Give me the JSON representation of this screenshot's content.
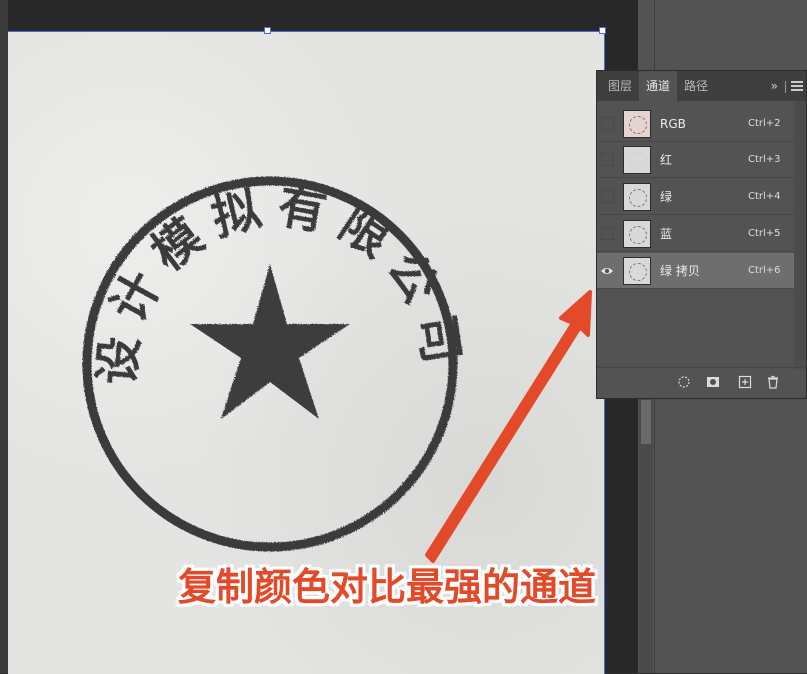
{
  "panel": {
    "tabs": [
      {
        "label": "图层",
        "active": false
      },
      {
        "label": "通道",
        "active": true
      },
      {
        "label": "路径",
        "active": false
      }
    ],
    "collapse_glyph": "»",
    "menu_icon": "hamburger-menu-icon",
    "channels": [
      {
        "name": "RGB",
        "shortcut": "Ctrl+2",
        "visible": false,
        "selected": false,
        "thumb": "rgb"
      },
      {
        "name": "红",
        "shortcut": "Ctrl+3",
        "visible": false,
        "selected": false,
        "thumb": "red"
      },
      {
        "name": "绿",
        "shortcut": "Ctrl+4",
        "visible": false,
        "selected": false,
        "thumb": "green"
      },
      {
        "name": "蓝",
        "shortcut": "Ctrl+5",
        "visible": false,
        "selected": false,
        "thumb": "blue"
      },
      {
        "name": "绿 拷贝",
        "shortcut": "Ctrl+6",
        "visible": true,
        "selected": true,
        "thumb": "copy"
      }
    ],
    "footer_buttons": [
      {
        "icon": "load-selection-icon"
      },
      {
        "icon": "save-selection-icon"
      },
      {
        "icon": "new-channel-icon"
      },
      {
        "icon": "delete-channel-icon"
      }
    ]
  },
  "canvas": {
    "stamp_text": "设计模拟有限公司",
    "stamp_color": "#3a3a3a"
  },
  "annotation": {
    "text": "复制颜色对比最强的通道",
    "color": "#e24a2a"
  }
}
